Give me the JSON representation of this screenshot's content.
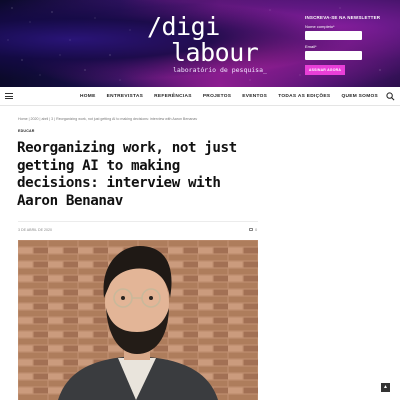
{
  "logo": {
    "line1": "/digi",
    "line2": "labour",
    "subtitle": "laboratório de pesquisa_"
  },
  "newsletter": {
    "title": "INSCREVA-SE NA NEWSLETTER",
    "name_label": "Nome completo*",
    "email_label": "Email*",
    "button": "ASSINAR AGORA"
  },
  "nav": {
    "items": [
      "HOME",
      "ENTREVISTAS",
      "REFERÊNCIAS",
      "PROJETOS",
      "EVENTOS",
      "TODAS AS EDIÇÕES",
      "QUEM SOMOS"
    ]
  },
  "article": {
    "breadcrumb": "Home | 2020 | abril | 3 | Reorganizing work, not just getting AI to making decisions: interview with Aaron Benanav",
    "category": "EDUCAR",
    "title": "Reorganizing work, not just getting AI to making decisions: interview with Aaron Benanav",
    "date": "3 DE ABRIL DE 2020",
    "comments": "0"
  },
  "colors": {
    "accent": "#e93fd8",
    "banner_dark": "#1a1050",
    "banner_magenta": "#8a1c8e"
  },
  "icons": {
    "menu": "hamburger-icon",
    "search": "search-icon",
    "comments": "comment-icon",
    "scroll_top": "arrow-up-icon"
  }
}
